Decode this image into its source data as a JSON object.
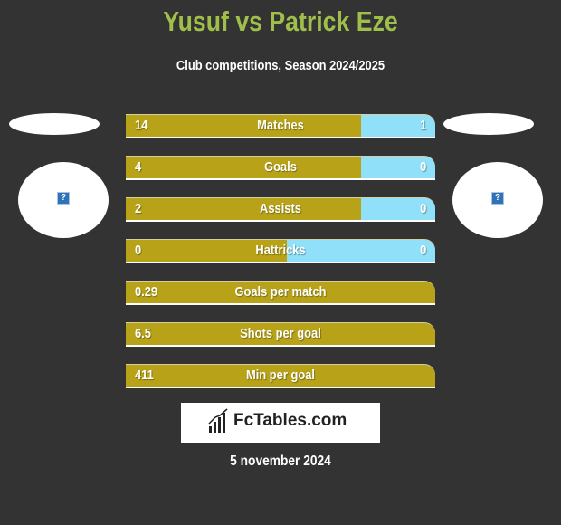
{
  "header": {
    "title": "Yusuf vs Patrick Eze",
    "subtitle": "Club competitions, Season 2024/2025"
  },
  "players": {
    "left": {
      "name": "Yusuf",
      "image_icon": "missing-image-icon"
    },
    "right": {
      "name": "Patrick Eze",
      "image_icon": "missing-image-icon"
    }
  },
  "colors": {
    "left_bar": "#b8a318",
    "right_bar": "#8fe0f8",
    "title": "#9fbe4a",
    "background": "#333333"
  },
  "stats": [
    {
      "label": "Matches",
      "left": "14",
      "right": "1",
      "left_share": 0.76
    },
    {
      "label": "Goals",
      "left": "4",
      "right": "0",
      "left_share": 0.76
    },
    {
      "label": "Assists",
      "left": "2",
      "right": "0",
      "left_share": 0.76
    },
    {
      "label": "Hattricks",
      "left": "0",
      "right": "0",
      "left_share": 0.52
    },
    {
      "label": "Goals per match",
      "left": "0.29",
      "right": "",
      "left_share": 1.0
    },
    {
      "label": "Shots per goal",
      "left": "6.5",
      "right": "",
      "left_share": 1.0
    },
    {
      "label": "Min per goal",
      "left": "411",
      "right": "",
      "left_share": 1.0
    }
  ],
  "logo": {
    "text": "FcTables.com"
  },
  "footer": {
    "date": "5 november 2024"
  }
}
